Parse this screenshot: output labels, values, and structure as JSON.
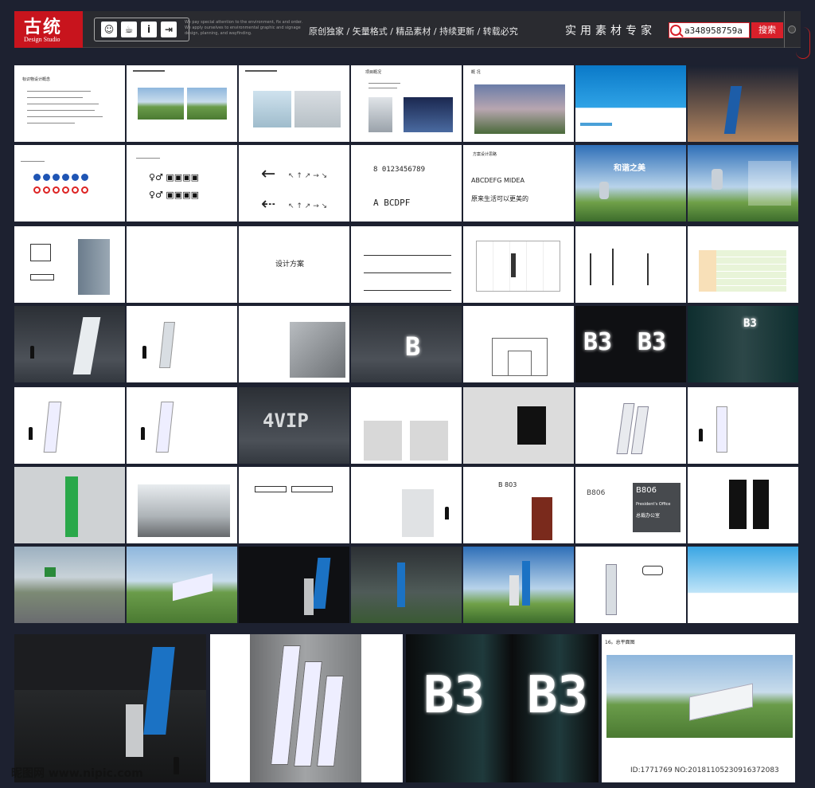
{
  "header": {
    "logo_cn": "古统",
    "logo_en": "Design Studio",
    "tiny_text": "We pay special attention to the environment, fix and order. We apply ourselves to environmental graphic and signage design, planning, and wayfinding.",
    "slogan": "原创独家 / 矢量格式 / 精品素材 / 持续更新 / 转载必究",
    "expert": "实用素材专家",
    "search_value": "a348958759a",
    "search_button": "搜索",
    "icons": [
      "person-icon",
      "cup-icon",
      "info-icon",
      "exit-icon"
    ]
  },
  "thumbs": {
    "r1c1_title": "标识物设计概念",
    "r1c3_title": "项目概况",
    "r1c5_title": "概 况",
    "r2c4_chars": "8 0123456789",
    "r2c4_alpha": "A BCDPF",
    "r2c5_title": "方案设计思路",
    "r2c5_font": "ABCDEFG MIDEA",
    "r2c5_slogan": "原来生活可以更美的",
    "r2c6_title": "和谐之美",
    "r3c2_title": "设计方案",
    "b803": "B 803",
    "b806": "B806",
    "president": "President's Office",
    "president_cn": "总裁办公室",
    "vip": "4VIP",
    "b3": "B3",
    "b3_alt": "B3",
    "b_big": "B",
    "section16": "16。总平面图"
  },
  "watermark": {
    "left": "昵图网 www.nipic.com",
    "right": "ID:1771769 NO:20181105230916372083"
  }
}
